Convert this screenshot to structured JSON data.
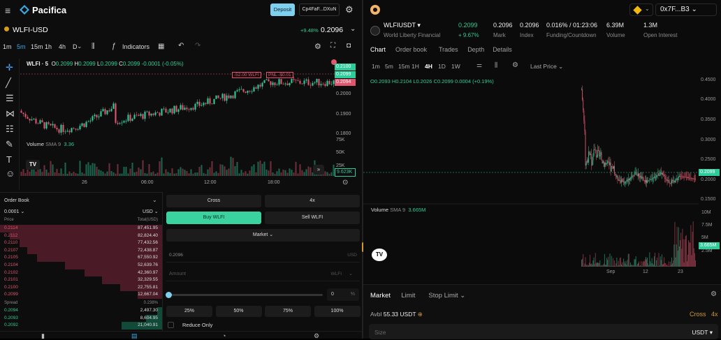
{
  "left": {
    "brand": "Pacifica",
    "deposit_label": "Deposit",
    "wallet_label": "Cp4FaF...DXuN",
    "symbol": "WLFI-USD",
    "change_pct": "+9.48%",
    "price": "0.2096",
    "timeframes": [
      "1m",
      "5m",
      "15m",
      "1h",
      "4h",
      "D"
    ],
    "active_timeframe": "5m",
    "indicators_label": "Indicators",
    "ohlc_symbol": "WLFI · 5",
    "ohlc": {
      "o_label": "O",
      "o": "0.2099",
      "h_label": "H",
      "h": "0.2099",
      "l_label": "L",
      "l": "0.2099",
      "c_label": "C",
      "c": "0.2099",
      "chg": "-0.0001 (-0.05%)"
    },
    "price_axis": [
      "0.2100",
      "0.2099",
      "0.2094",
      "0.2000",
      "0.1900",
      "0.1800"
    ],
    "position_label": "-52.00 WLFI",
    "pnl_label": "PNL -$0.01",
    "volume_label": "Volume",
    "volume_sma": "SMA 9",
    "volume_value": "3.36",
    "vol_axis": [
      "75K",
      "50K",
      "25K"
    ],
    "vol_last": "9.623K",
    "time_axis": [
      "26",
      "06:00",
      "12:00",
      "18:00"
    ],
    "orderbook": {
      "title": "Order Book",
      "tick": "0.0001",
      "currency": "USD",
      "col_price": "Price",
      "col_total": "Total(USD)",
      "asks": [
        {
          "p": "0.2114",
          "t": "87,451.95",
          "w": 1.0
        },
        {
          "p": "0.2112",
          "t": "82,824.40",
          "w": 0.94
        },
        {
          "p": "0.2110",
          "t": "77,432.56",
          "w": 0.88
        },
        {
          "p": "0.2107",
          "t": "72,438.87",
          "w": 0.83
        },
        {
          "p": "0.2105",
          "t": "67,550.92",
          "w": 0.77
        },
        {
          "p": "0.2104",
          "t": "52,639.76",
          "w": 0.6
        },
        {
          "p": "0.2102",
          "t": "42,360.97",
          "w": 0.48
        },
        {
          "p": "0.2101",
          "t": "32,329.55",
          "w": 0.37
        },
        {
          "p": "0.2100",
          "t": "22,755.81",
          "w": 0.26
        },
        {
          "p": "0.2099",
          "t": "12,667.04",
          "w": 0.15
        }
      ],
      "spread_label": "Spread",
      "spread_value": "0.238%",
      "bids": [
        {
          "p": "0.2094",
          "t": "2,497.30",
          "w": 0.03
        },
        {
          "p": "0.2093",
          "t": "8,604.95",
          "w": 0.1
        },
        {
          "p": "0.2092",
          "t": "21,040.91",
          "w": 0.25
        }
      ]
    },
    "trade": {
      "cross": "Cross",
      "leverage": "4x",
      "buy": "Buy WLFI",
      "sell": "Sell WLFI",
      "order_type": "Market",
      "price_value": "0.2096",
      "price_unit": "USD",
      "amount_placeholder": "Amount",
      "amount_unit": "WLFI",
      "slider_value": "0",
      "slider_unit": "%",
      "pcts": [
        "25%",
        "50%",
        "75%",
        "100%"
      ],
      "reduce_only": "Reduce Only"
    }
  },
  "right": {
    "wallet": "0x7F...B3",
    "symbol": "WLFIUSDT",
    "name": "World Liberty Financial",
    "price": "0.2099",
    "change": "+ 9.67%",
    "mark": "0.2096",
    "mark_label": "Mark",
    "index": "0.2096",
    "index_label": "Index",
    "funding": "0.016% / 01:23:06",
    "funding_label": "Funding/Countdown",
    "volume": "6.39M",
    "volume_label": "Volume",
    "oi": "1.3M",
    "oi_label": "Open Interest",
    "tabs": [
      "Chart",
      "Order book",
      "Trades",
      "Depth",
      "Details"
    ],
    "active_tab": "Chart",
    "timeframes": [
      "1m",
      "5m",
      "15m",
      "1H",
      "4H",
      "1D",
      "1W"
    ],
    "active_timeframe": "4H",
    "last_price": "Last Price",
    "ohlc": {
      "o_label": "O",
      "o": "0.2093",
      "h_label": "H",
      "h": "0.2104",
      "l_label": "L",
      "l": "0.2026",
      "c_label": "C",
      "c": "0.2099",
      "chg": "0.0004 (+0.19%)"
    },
    "price_axis": [
      "0.4500",
      "0.4000",
      "0.3500",
      "0.3000",
      "0.2500",
      "0.2000",
      "0.1500"
    ],
    "price_tag": "0.2099",
    "volume_sma": "SMA 9",
    "volume_value": "3.665M",
    "vol_axis": [
      "10M",
      "7.5M",
      "5M",
      "2.5M"
    ],
    "vol_last": "3.665M",
    "time_axis": [
      "Sep",
      "12",
      "23"
    ],
    "order_tabs": [
      "Market",
      "Limit",
      "Stop Limit"
    ],
    "avbl_label": "Avbl",
    "avbl_value": "55.33 USDT",
    "cross": "Cross",
    "leverage": "4x",
    "size_placeholder": "Size",
    "size_unit": "USDT"
  }
}
